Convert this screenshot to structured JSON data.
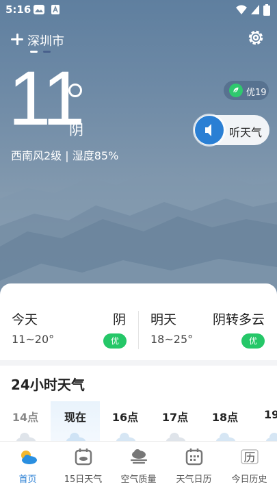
{
  "status_bar": {
    "time": "5:16"
  },
  "header": {
    "city": "深圳市"
  },
  "current": {
    "temperature": "11",
    "condition": "阴",
    "wind_humidity": "西南风2级 | 湿度85%",
    "aqi_label": "优19",
    "listen_label": "听天气"
  },
  "forecast": {
    "today": {
      "day": "今天",
      "condition": "阴",
      "range": "11~20°",
      "quality": "优"
    },
    "tomorrow": {
      "day": "明天",
      "condition": "阴转多云",
      "range": "18~25°",
      "quality": "优"
    }
  },
  "hourly": {
    "title": "24小时天气",
    "hours": [
      "14点",
      "现在",
      "16点",
      "17点",
      "18点",
      "19"
    ]
  },
  "nav": {
    "items": [
      "首页",
      "15日天气",
      "空气质量",
      "天气日历",
      "今日历史"
    ],
    "calendar_glyph": "历"
  },
  "colors": {
    "accent": "#2a7fd4",
    "good_quality": "#25c768",
    "hero_top": "#5f7f9f"
  }
}
